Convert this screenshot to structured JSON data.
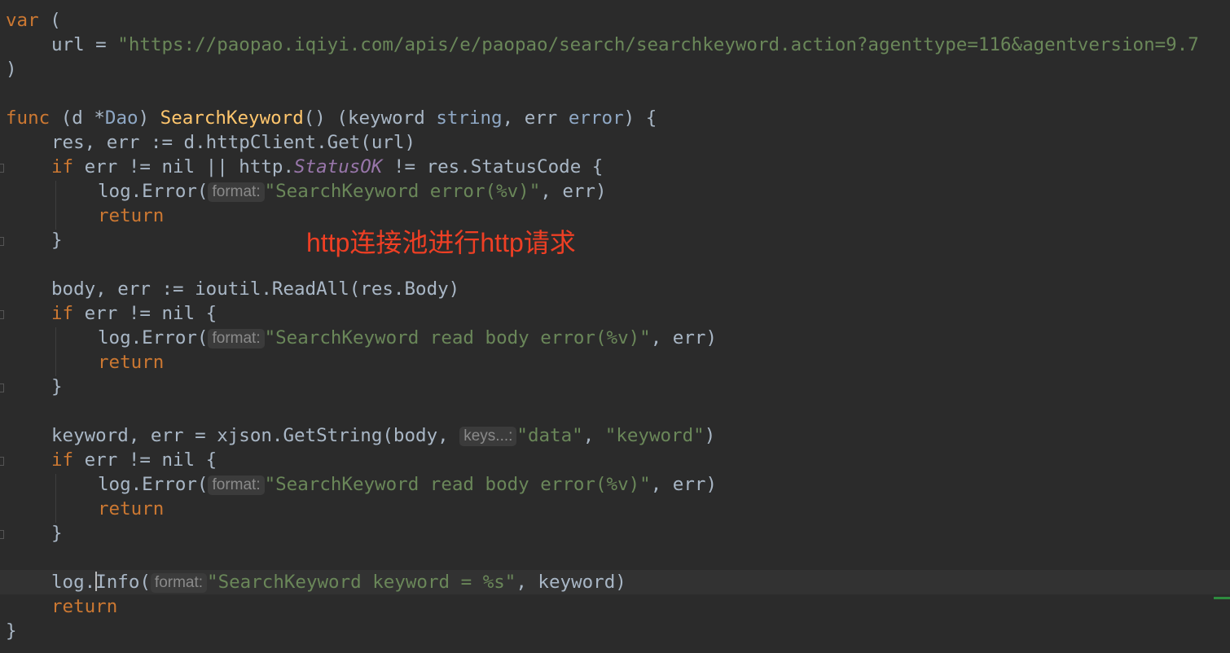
{
  "code": {
    "var_kw": "var",
    "paren_open": "(",
    "paren_close": ")",
    "url_var": "url",
    "url_assign": " = ",
    "url_value": "\"https://paopao.iqiyi.com/apis/e/paopao/search/searchkeyword.action?agenttype=116&agentversion=9.7",
    "func_kw": "func",
    "receiver_open": " (d *",
    "receiver_type": "Dao",
    "receiver_close": ") ",
    "func_name": "SearchKeyword",
    "params_open": "() (keyword ",
    "string_type": "string",
    "params_mid": ", err ",
    "error_type": "error",
    "params_close": ") {",
    "l6": "res, err := d.httpClient.Get(url)",
    "if_kw": "if",
    "l7_a": " err != nil || http.",
    "status_ok": "StatusOK",
    "l7_b": " != res.StatusCode {",
    "log_error": "log.Error(",
    "hint_format": "format:",
    "msg1": "\"SearchKeyword error(%v)\"",
    "args_err": ", err)",
    "return_kw": "return",
    "close_brace": "}",
    "l12": "body, err := ioutil.ReadAll(res.Body)",
    "if_err_nil": " err != nil {",
    "msg2": "\"SearchKeyword read body error(%v)\"",
    "l18_a": "keyword, err = xjson.GetString(body, ",
    "hint_keys": "keys...:",
    "str_data": "\"data\"",
    "comma": ", ",
    "str_keyword": "\"keyword\"",
    "rparen": ")",
    "log_prefix": "log.",
    "info_fn": "Info(",
    "msg3": "\"SearchKeyword keyword = %s\"",
    "args_keyword": ", keyword)"
  },
  "annotation": "http连接池进行http请求",
  "colors": {
    "background": "#2b2b2b",
    "keyword": "#cc7832",
    "string": "#6a8759",
    "function": "#ffc66d",
    "constant": "#9876aa",
    "annotation": "#ee3f24"
  }
}
